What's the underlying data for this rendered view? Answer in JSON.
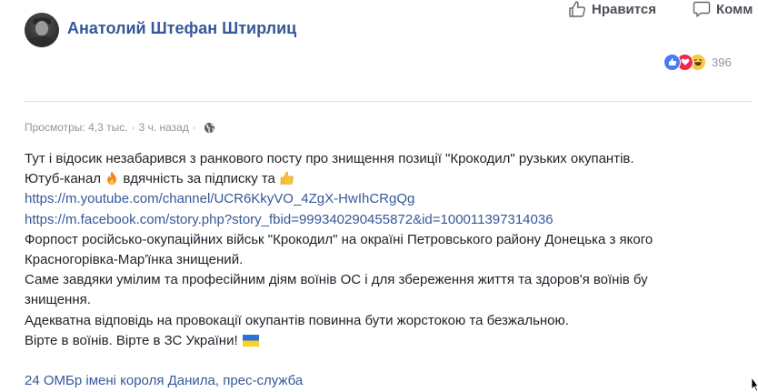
{
  "post": {
    "author": "Анатолий Штефан Штирлиц",
    "actions": {
      "like_label": "Нравится",
      "comment_label": "Комм"
    },
    "reactions": {
      "count": "396",
      "types": [
        "like-icon",
        "love-icon",
        "haha-icon"
      ]
    },
    "meta": {
      "views": "Просмотры: 4,3 тыс.",
      "time": "3 ч. назад",
      "privacy_icon": "globe-icon"
    },
    "body": {
      "line1": "Тут і відосик незабарився з ранкового посту про знищення позиції \"Крокодил\" рузьких окупантів.",
      "line2_a": "Ютуб-канал",
      "line2_b": "вдячність за підписку та",
      "link_youtube": "https://m.youtube.com/channel/UCR6KkyVO_4ZgX-HwIhCRgQg",
      "link_facebook": "https://m.facebook.com/story.php?story_fbid=999340290455872&id=100011397314036",
      "line5": "Форпост російсько-окупаційних військ \"Крокодил\" на окраїні Петровського району Донецька з якого",
      "line6": "Красногорівка-Мар'їнка знищений.",
      "line7": "Саме завдяки умілим та професійним діям воїнів ОС і для збереження життя та здоров'я воїнів бу",
      "line8": "знищення.",
      "line9": "Адекватна відповідь на провокації окупантів повинна бути жорстокою та безжальною.",
      "line10": "Вірте в воїнів. Вірте в ЗС України!"
    },
    "footer_link": "24 ОМБр імені короля Данила, прес-служба"
  },
  "colors": {
    "link": "#365899",
    "text": "#1d2129",
    "meta": "#90949c",
    "like_blue": "#4a7bf0",
    "love_red": "#f0284a",
    "haha_yellow": "#f7c948"
  }
}
